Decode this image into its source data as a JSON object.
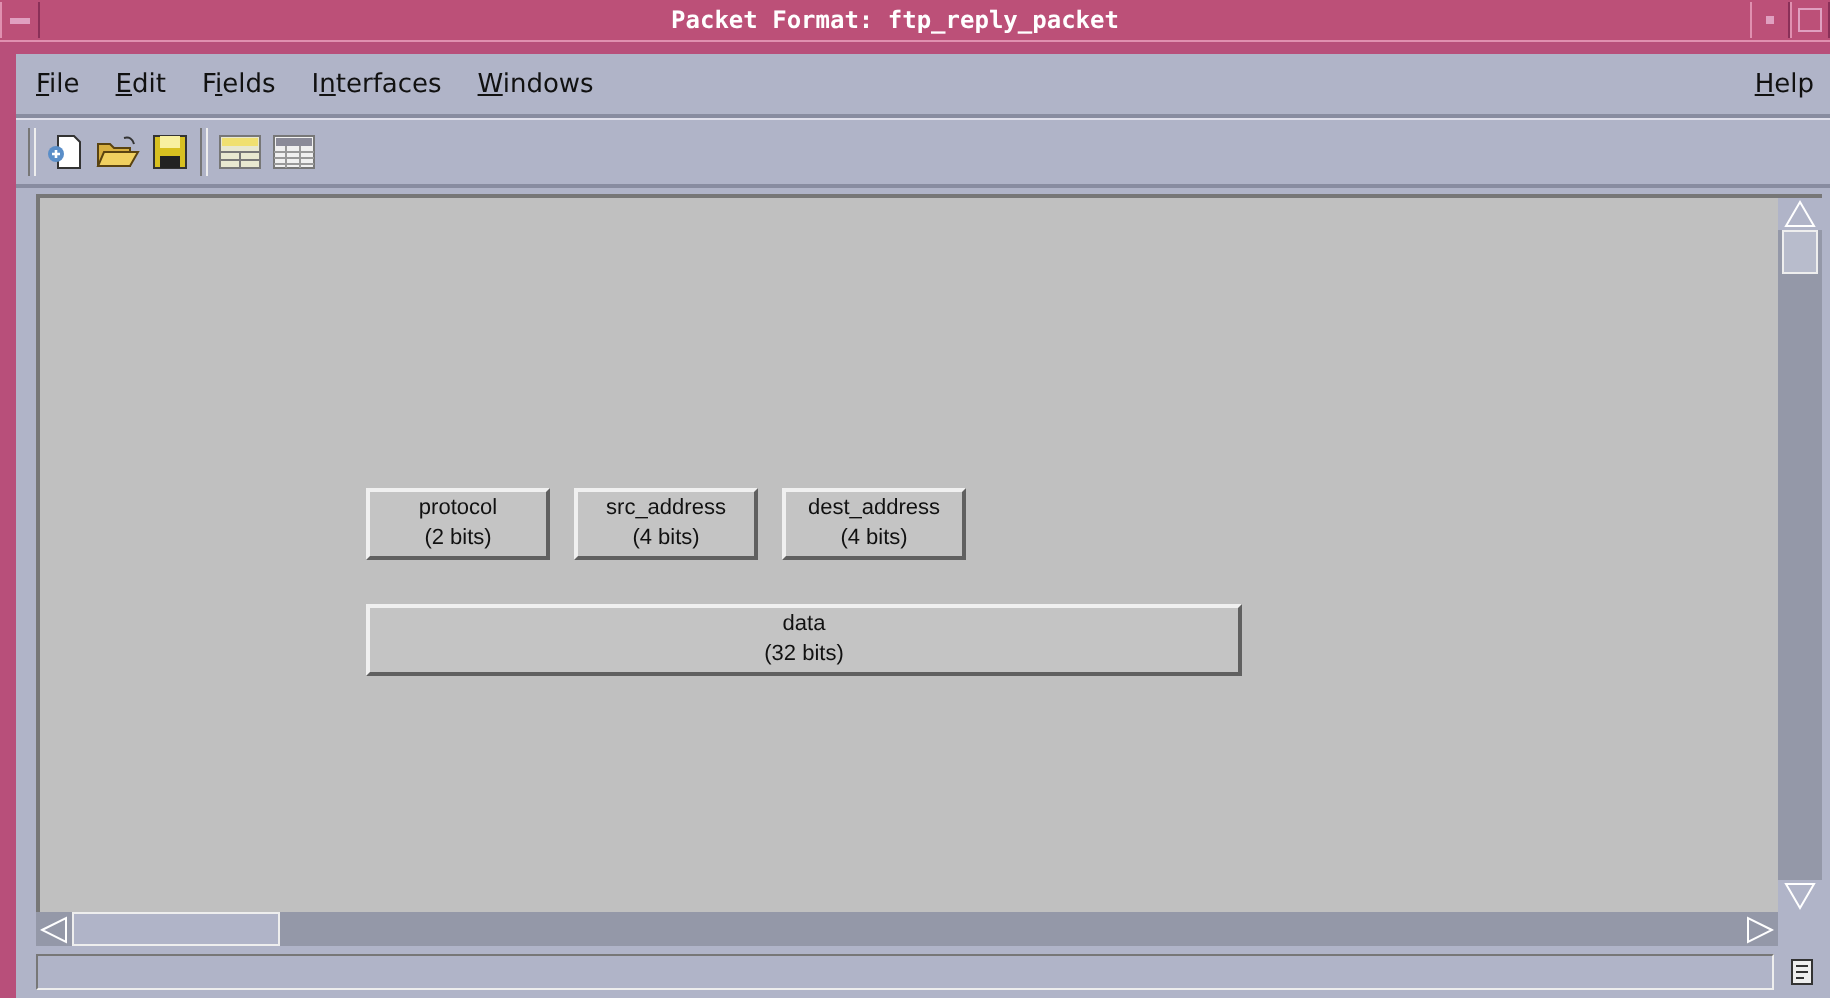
{
  "window": {
    "title": "Packet Format: ftp_reply_packet"
  },
  "menu": [
    {
      "label": [
        {
          "text": "F",
          "underlined": true
        },
        {
          "text": "ile",
          "underlined": false
        }
      ]
    },
    {
      "label": [
        {
          "text": "E",
          "underlined": true
        },
        {
          "text": "dit",
          "underlined": false
        }
      ]
    },
    {
      "label": [
        {
          "text": "F",
          "underlined": false
        },
        {
          "text": "i",
          "underlined": true
        },
        {
          "text": "elds",
          "underlined": false
        }
      ]
    },
    {
      "label": [
        {
          "text": "I",
          "underlined": false
        },
        {
          "text": "n",
          "underlined": true
        },
        {
          "text": "terfaces",
          "underlined": false
        }
      ]
    },
    {
      "label": [
        {
          "text": "W",
          "underlined": true
        },
        {
          "text": "indows",
          "underlined": false
        }
      ]
    }
  ],
  "help_menu": {
    "label": [
      {
        "text": "H",
        "underlined": true
      },
      {
        "text": "elp",
        "underlined": false
      }
    ]
  },
  "toolbar": [
    {
      "kind": "new"
    },
    {
      "kind": "open"
    },
    {
      "kind": "save"
    },
    {
      "kind": "fields"
    },
    {
      "kind": "attributes"
    }
  ],
  "canvas": {
    "rows": [
      [
        {
          "name": "protocol",
          "size": "(2 bits)"
        },
        {
          "name": "src_address",
          "size": "(4 bits)"
        },
        {
          "name": "dest_address",
          "size": "(4 bits)"
        }
      ],
      [
        {
          "name": "data",
          "size": "(32 bits)"
        }
      ]
    ]
  }
}
